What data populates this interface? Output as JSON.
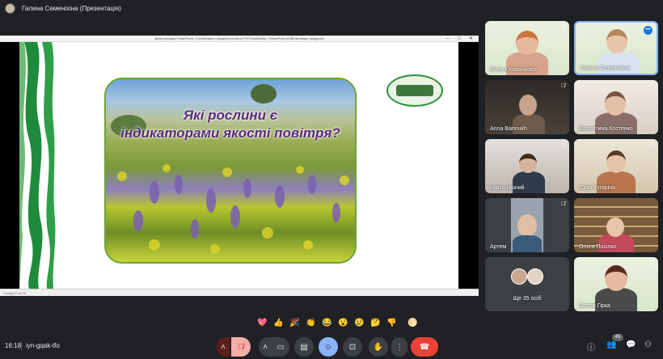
{
  "topbar": {
    "presenter": "Галина Семеніхіна (Презентація)"
  },
  "ppt": {
    "window_title": "Демонстрація PowerPoint - [Особливості лекційної роботи FTFF.KatMeMa] - PowerPoint (Сбій активації продукту)",
    "status": "Слайд 22 из 22"
  },
  "slide": {
    "title_line1": "Які рослини є",
    "title_line2": "індикаторами якості повітря?"
  },
  "tiles": [
    {
      "name": "Олена Ковальова",
      "muted": true
    },
    {
      "name": "Галина Семеніхіна",
      "muted": false
    },
    {
      "name": "Anna Bannukh",
      "muted": true
    },
    {
      "name": "Валентина Костенко",
      "muted": false
    },
    {
      "name": "Нікіта Яшний",
      "muted": true
    },
    {
      "name": "Юлія Тугаріна",
      "muted": true
    },
    {
      "name": "Артем",
      "muted": true
    },
    {
      "name": "Ольга Похілко",
      "muted": false
    },
    {
      "name": "Ще 35 осіб",
      "muted": false
    },
    {
      "name": "Олеся Гірка",
      "muted": true
    }
  ],
  "reactions": [
    "💖",
    "👍",
    "🎉",
    "👏",
    "😂",
    "😮",
    "😢",
    "🤔",
    "👎",
    "🌕"
  ],
  "bottombar": {
    "time": "16:18",
    "meeting_code": "iyn-gqak-tfo",
    "participants_count": "45"
  }
}
